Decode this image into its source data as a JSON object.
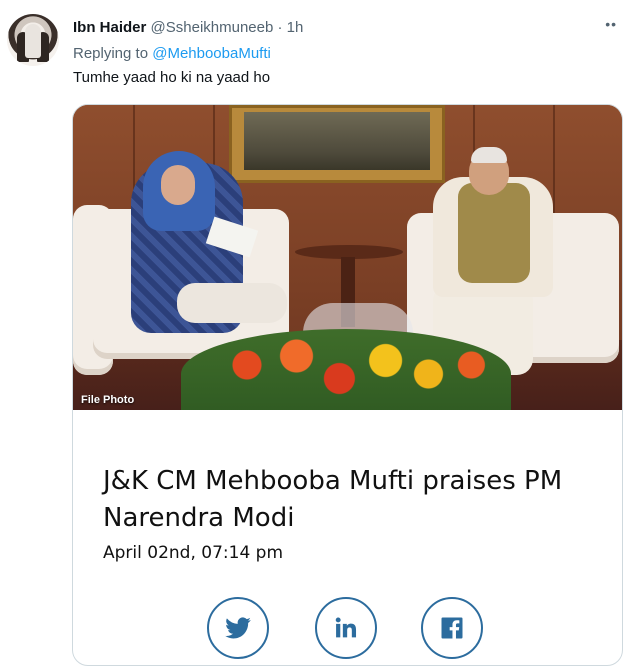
{
  "tweet": {
    "author_name": "Ibn Haider",
    "author_handle": "@Ssheikhmuneeb",
    "time": "· 1h",
    "more_icon": "more-horizontal-icon",
    "replying_prefix": "Replying to",
    "replying_to": "@MehboobaMufti",
    "text": "Tumhe yaad ho ki na yaad ho"
  },
  "card": {
    "photo_caption": "File Photo",
    "title": "J&K CM Mehbooba Mufti praises PM Narendra Modi",
    "date": "April 02nd, 07:14 pm",
    "share_icons": [
      "twitter-icon",
      "linkedin-icon",
      "facebook-icon"
    ]
  },
  "colors": {
    "link": "#1d9bf0",
    "muted": "#536471",
    "share_accent": "#2c6c9e"
  }
}
